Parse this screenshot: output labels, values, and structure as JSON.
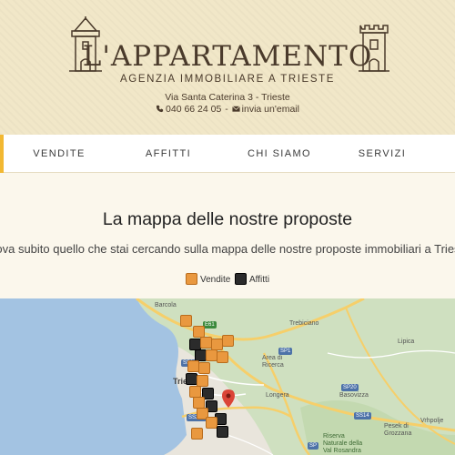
{
  "header": {
    "brand": "L'APPARTAMENTO",
    "tagline": "AGENZIA IMMOBILIARE A TRIESTE",
    "address": "Via Santa Caterina 3 - Trieste",
    "phone": "040 66 24 05",
    "email_link": "invia un'email"
  },
  "nav": {
    "items": [
      {
        "label": "VENDITE"
      },
      {
        "label": "AFFITTI"
      },
      {
        "label": "CHI SIAMO"
      },
      {
        "label": "SERVIZI"
      }
    ]
  },
  "main": {
    "title": "La mappa delle nostre proposte",
    "subtitle": "Trova subito quello che stai cercando sulla mappa delle nostre proposte immobiliari a Trieste",
    "legend": {
      "sale_label": "Vendite",
      "rent_label": "Affitti"
    }
  },
  "map": {
    "labels": {
      "barcola": "Barcola",
      "trebiciano": "Trebiciano",
      "lipica": "Lipica",
      "area_ricerca": "Area di\nRicerca",
      "trie": "Trie",
      "longera": "Longera",
      "basovizza": "Basovizza",
      "pesek": "Pesek di\nGrozzana",
      "riserva": "Riserva\nNaturale della\nVal Rosandra",
      "vrhpolje": "Vrhpolje"
    },
    "badges": {
      "e61": "E61",
      "sp1": "SP1",
      "ss14a": "SS14",
      "ss14b": "SS14",
      "ss202": "SS202",
      "sp20": "SP20",
      "sp": "SP"
    }
  },
  "colors": {
    "accent": "#f2b832",
    "sale": "#e9983f",
    "rent": "#2b2b2b",
    "sea": "#a3c3e2",
    "road_major": "#f6cf6a"
  }
}
